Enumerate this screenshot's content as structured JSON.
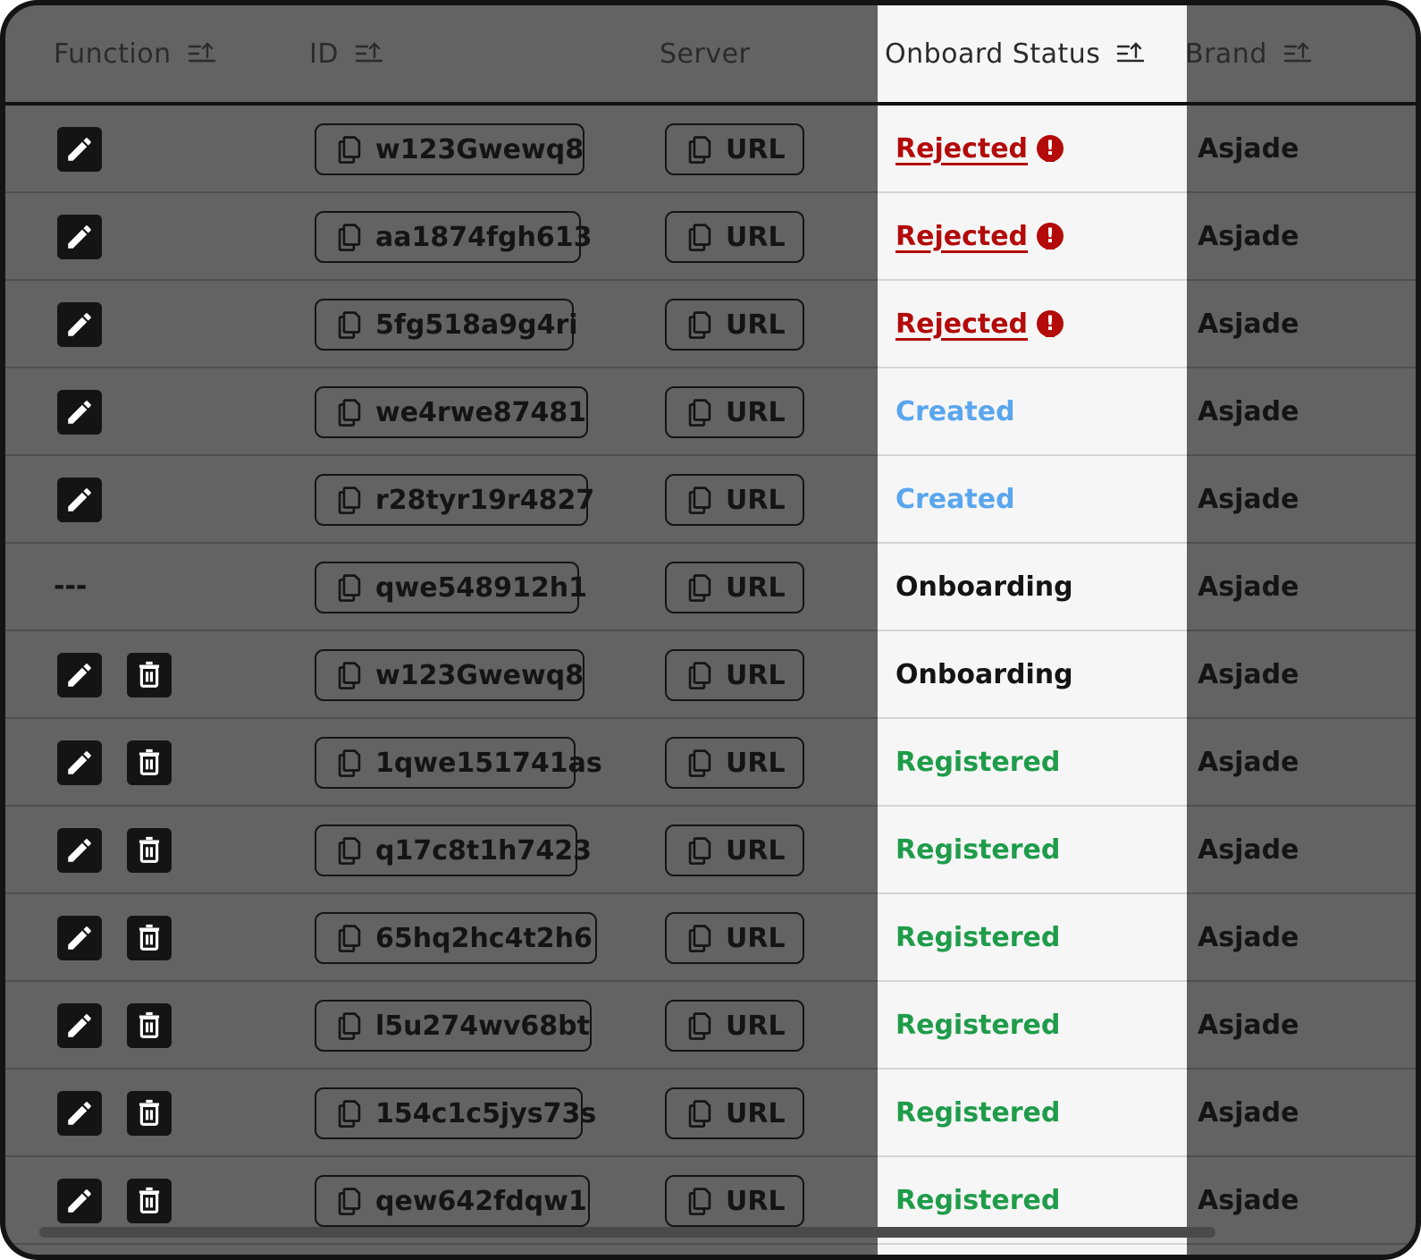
{
  "columns": {
    "function": "Function",
    "id": "ID",
    "server": "Server",
    "status": "Onboard Status",
    "brand": "Brand"
  },
  "empty_function": "---",
  "server_label": "URL",
  "colors": {
    "frame": "#141414",
    "background": "#636363",
    "highlight_column": "#f6f6f6",
    "rejected": "#b30a0a",
    "created": "#5aa6ee",
    "onboarding": "#141414",
    "registered": "#1f9c4a"
  },
  "rows": [
    {
      "functions": [
        "edit"
      ],
      "id": "w123Gwewq8",
      "status": "Rejected",
      "status_type": "rejected",
      "brand": "Asjade"
    },
    {
      "functions": [
        "edit"
      ],
      "id": "aa1874fgh613",
      "status": "Rejected",
      "status_type": "rejected",
      "brand": "Asjade"
    },
    {
      "functions": [
        "edit"
      ],
      "id": "5fg518a9g4ri",
      "status": "Rejected",
      "status_type": "rejected",
      "brand": "Asjade"
    },
    {
      "functions": [
        "edit"
      ],
      "id": "we4rwe87481",
      "status": "Created",
      "status_type": "created",
      "brand": "Asjade"
    },
    {
      "functions": [
        "edit"
      ],
      "id": "r28tyr19r4827",
      "status": "Created",
      "status_type": "created",
      "brand": "Asjade"
    },
    {
      "functions": [],
      "id": "qwe548912h1",
      "status": "Onboarding",
      "status_type": "onboarding",
      "brand": "Asjade"
    },
    {
      "functions": [
        "edit",
        "delete"
      ],
      "id": "w123Gwewq8",
      "status": "Onboarding",
      "status_type": "onboarding",
      "brand": "Asjade"
    },
    {
      "functions": [
        "edit",
        "delete"
      ],
      "id": "1qwe151741as",
      "status": "Registered",
      "status_type": "registered",
      "brand": "Asjade"
    },
    {
      "functions": [
        "edit",
        "delete"
      ],
      "id": "q17c8t1h7423",
      "status": "Registered",
      "status_type": "registered",
      "brand": "Asjade"
    },
    {
      "functions": [
        "edit",
        "delete"
      ],
      "id": "65hq2hc4t2h6",
      "status": "Registered",
      "status_type": "registered",
      "brand": "Asjade"
    },
    {
      "functions": [
        "edit",
        "delete"
      ],
      "id": "l5u274wv68bt",
      "status": "Registered",
      "status_type": "registered",
      "brand": "Asjade"
    },
    {
      "functions": [
        "edit",
        "delete"
      ],
      "id": "154c1c5jys73s",
      "status": "Registered",
      "status_type": "registered",
      "brand": "Asjade"
    },
    {
      "functions": [
        "edit",
        "delete"
      ],
      "id": "qew642fdqw1",
      "status": "Registered",
      "status_type": "registered",
      "brand": "Asjade"
    }
  ]
}
